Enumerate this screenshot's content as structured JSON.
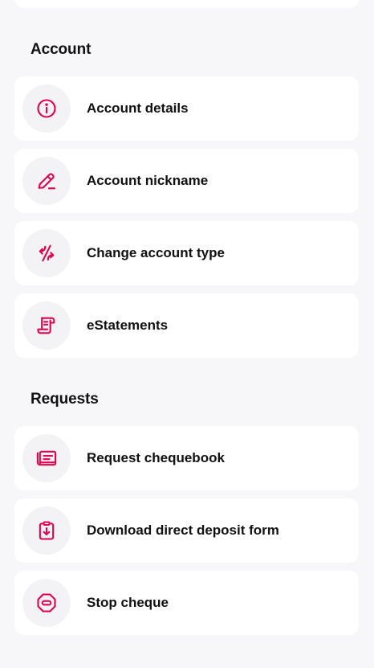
{
  "accent_color": "#e0004d",
  "sections": {
    "account": {
      "title": "Account",
      "items": [
        {
          "label": "Account details",
          "icon": "info-circle-icon"
        },
        {
          "label": "Account nickname",
          "icon": "pencil-icon"
        },
        {
          "label": "Change account type",
          "icon": "swap-arrows-icon"
        },
        {
          "label": "eStatements",
          "icon": "scroll-document-icon"
        }
      ]
    },
    "requests": {
      "title": "Requests",
      "items": [
        {
          "label": "Request chequebook",
          "icon": "chequebook-icon"
        },
        {
          "label": "Download direct deposit form",
          "icon": "clipboard-download-icon"
        },
        {
          "label": "Stop cheque",
          "icon": "stop-octagon-icon"
        }
      ]
    }
  }
}
